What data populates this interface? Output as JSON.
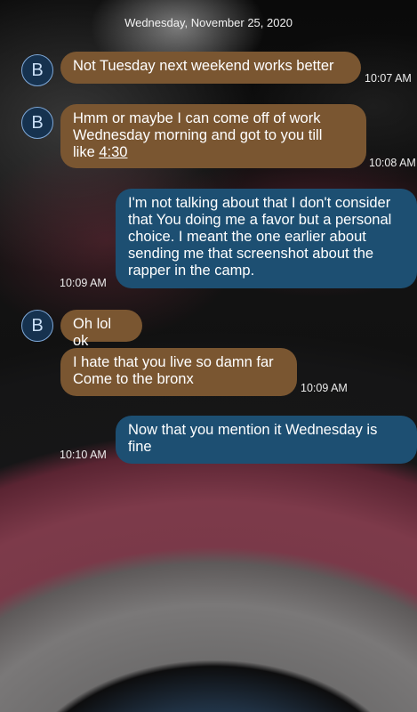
{
  "thread": {
    "date_header": "Wednesday, November 25, 2020",
    "contact_initial": "B",
    "messages": [
      {
        "direction": "incoming",
        "text": "Not Tuesday next weekend works better",
        "time": "10:07 AM"
      },
      {
        "direction": "incoming",
        "text_before_link": "Hmm or maybe I can come off of work\nWednesday morning and got to you till\nlike ",
        "link_text": "4:30",
        "time": "10:08 AM"
      },
      {
        "direction": "outgoing",
        "text": "I'm not talking about that I don't consider\nthat  You doing me a favor but a personal\nchoice. I meant the one earlier about\nsending me that screenshot about the\nrapper in the camp.",
        "time": "10:09 AM"
      },
      {
        "direction": "incoming",
        "text": "Oh lol ok",
        "time": ""
      },
      {
        "direction": "incoming",
        "text": "I hate that you live so damn far\nCome to the bronx",
        "time": "10:09 AM"
      },
      {
        "direction": "outgoing",
        "text": "Now that you mention it Wednesday is\nfine",
        "time": "10:10 AM"
      }
    ]
  },
  "colors": {
    "incoming_bubble": "#7a5631",
    "outgoing_bubble": "#1d4f72",
    "avatar_ring": "#7fa9d9"
  }
}
